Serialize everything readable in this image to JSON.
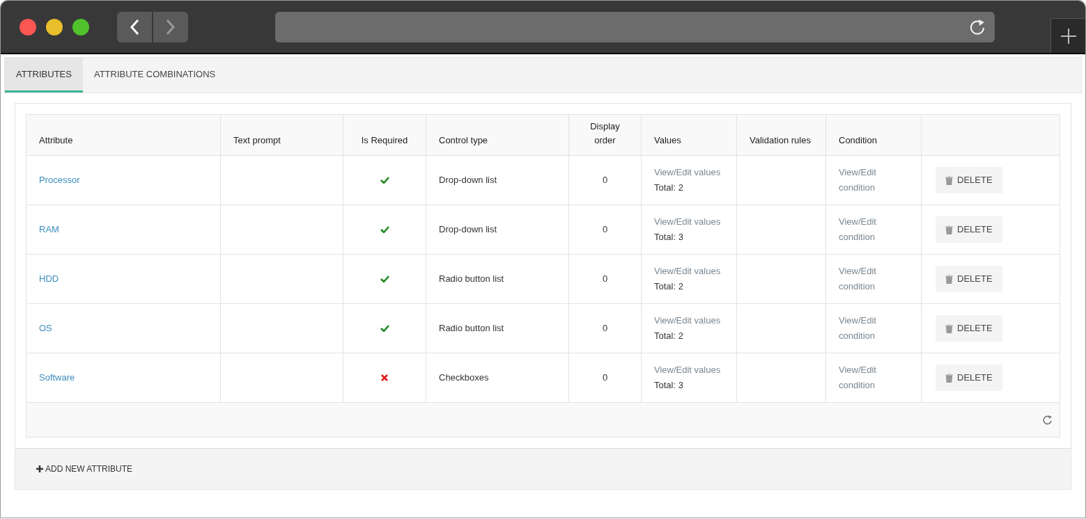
{
  "tabs": [
    {
      "label": "ATTRIBUTES",
      "selected": true
    },
    {
      "label": "ATTRIBUTE COMBINATIONS",
      "selected": false
    }
  ],
  "table": {
    "columns": [
      "Attribute",
      "Text prompt",
      "Is Required",
      "Control type",
      "Display order",
      "Values",
      "Validation rules",
      "Condition"
    ],
    "rows": [
      {
        "attribute": "Processor",
        "required": true,
        "control_type": "Drop-down list",
        "display_order": "0",
        "values_link": "View/Edit values",
        "values_total": "Total: 2",
        "condition_link": "View/Edit condition",
        "delete_label": "DELETE"
      },
      {
        "attribute": "RAM",
        "required": true,
        "control_type": "Drop-down list",
        "display_order": "0",
        "values_link": "View/Edit values",
        "values_total": "Total: 3",
        "condition_link": "View/Edit condition",
        "delete_label": "DELETE"
      },
      {
        "attribute": "HDD",
        "required": true,
        "control_type": "Radio button list",
        "display_order": "0",
        "values_link": "View/Edit values",
        "values_total": "Total: 2",
        "condition_link": "View/Edit condition",
        "delete_label": "DELETE"
      },
      {
        "attribute": "OS",
        "required": true,
        "control_type": "Radio button list",
        "display_order": "0",
        "values_link": "View/Edit values",
        "values_total": "Total: 2",
        "condition_link": "View/Edit condition",
        "delete_label": "DELETE"
      },
      {
        "attribute": "Software",
        "required": false,
        "control_type": "Checkboxes",
        "display_order": "0",
        "values_link": "View/Edit values",
        "values_total": "Total: 3",
        "condition_link": "View/Edit condition",
        "delete_label": "DELETE"
      }
    ]
  },
  "add_button": {
    "label": "ADD NEW ATTRIBUTE"
  }
}
